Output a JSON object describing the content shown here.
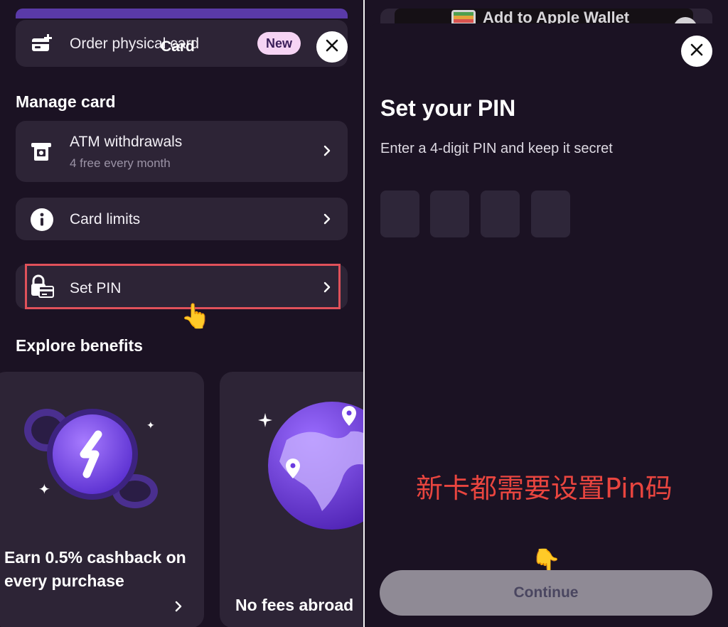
{
  "left": {
    "order": {
      "label": "Order physical card",
      "title": "Card",
      "badge": "New"
    },
    "manage_title": "Manage card",
    "rows": [
      {
        "label": "ATM withdrawals",
        "sublabel": "4 free every month",
        "icon": "atm-icon"
      },
      {
        "label": "Card limits",
        "icon": "info-icon"
      },
      {
        "label": "Set PIN",
        "icon": "lock-card-icon"
      }
    ],
    "benefits_title": "Explore benefits",
    "benefits": [
      {
        "text": "Earn 0.5% cashback on every purchase",
        "icon": "coin-illustration"
      },
      {
        "text": "No fees abroad",
        "icon": "globe-illustration"
      }
    ]
  },
  "right": {
    "wallet_label": "Add to Apple Wallet",
    "title": "Set your PIN",
    "subtitle": "Enter a 4-digit PIN and keep it secret",
    "pin_digits": [
      "",
      "",
      "",
      ""
    ],
    "annotation": "新卡都需要设置Pin码",
    "continue_label": "Continue"
  },
  "colors": {
    "background": "#1b1223",
    "card": "#2d2436",
    "accent_purple": "#7b4dff",
    "highlight_red": "#e0515a",
    "annotation_red": "#e9453f",
    "button_disabled": "#8f8a95"
  }
}
